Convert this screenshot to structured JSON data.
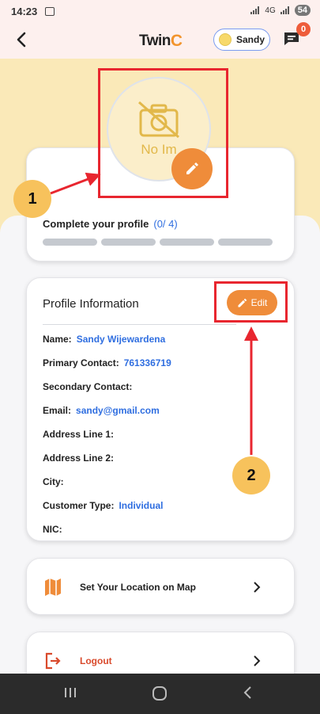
{
  "status_bar": {
    "time": "14:23",
    "signal_text": "4G",
    "battery": "54"
  },
  "header": {
    "logo_text": "Twin",
    "logo_accent": "C",
    "user_name": "Sandy",
    "chat_badge_count": "0"
  },
  "avatar": {
    "placeholder_text": "No Im"
  },
  "completion": {
    "title": "Complete your profile",
    "count": "(0/ 4)",
    "progress_completed": 0,
    "progress_total": 4
  },
  "profile_info": {
    "title": "Profile Information",
    "edit_label": "Edit",
    "fields": [
      {
        "label": "Name:",
        "value": "Sandy Wijewardena"
      },
      {
        "label": "Primary Contact:",
        "value": "761336719"
      },
      {
        "label": "Secondary Contact:",
        "value": ""
      },
      {
        "label": "Email:",
        "value": "sandy@gmail.com"
      },
      {
        "label": "Address Line 1:",
        "value": ""
      },
      {
        "label": "Address Line 2:",
        "value": ""
      },
      {
        "label": "City:",
        "value": ""
      },
      {
        "label": "Customer Type:",
        "value": "Individual"
      },
      {
        "label": "NIC:",
        "value": ""
      }
    ]
  },
  "nav_items": {
    "location_label": "Set Your Location on Map",
    "logout_label": "Logout"
  },
  "annotations": {
    "marker_1": "1",
    "marker_2": "2"
  },
  "colors": {
    "accent_orange": "#ef8c3a",
    "link_blue": "#2f6ee0",
    "annotation_red": "#e8262f",
    "marker_yellow": "#f7c25c",
    "hero_yellow": "#fae9b8"
  }
}
